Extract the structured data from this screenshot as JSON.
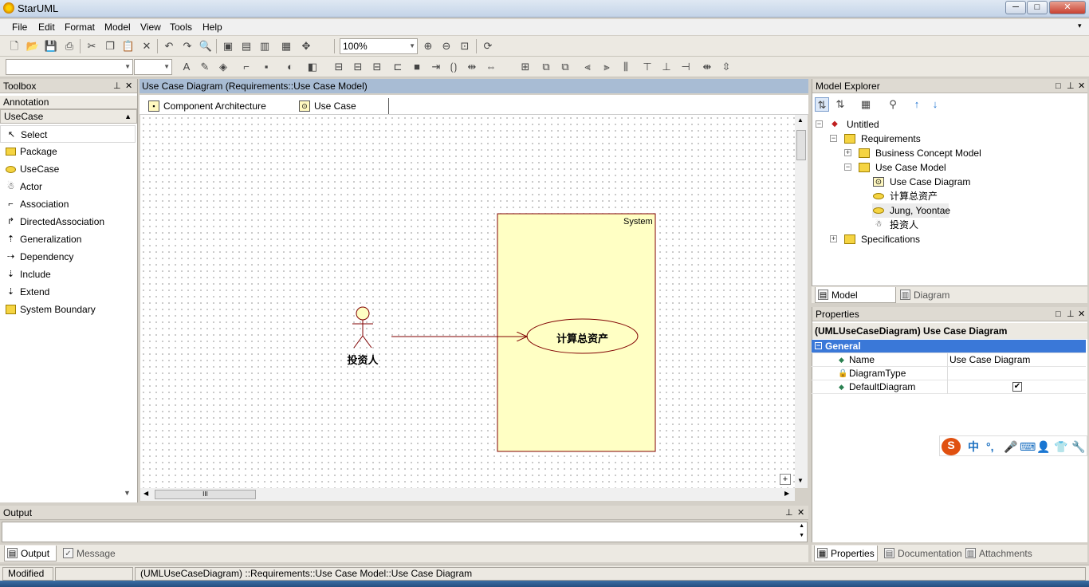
{
  "window": {
    "title": "StarUML",
    "minimize": "─",
    "maximize": "□",
    "close": "✕"
  },
  "menu": [
    "File",
    "Edit",
    "Format",
    "Model",
    "View",
    "Tools",
    "Help"
  ],
  "toolbar": {
    "zoom": "100%"
  },
  "toolbox": {
    "title": "Toolbox",
    "annotation_label": "Annotation",
    "category": "UseCase",
    "items": [
      {
        "label": "Select",
        "icon": "select-arrow-icon"
      },
      {
        "label": "Package",
        "icon": "package-icon"
      },
      {
        "label": "UseCase",
        "icon": "usecase-icon"
      },
      {
        "label": "Actor",
        "icon": "actor-icon"
      },
      {
        "label": "Association",
        "icon": "association-icon"
      },
      {
        "label": "DirectedAssociation",
        "icon": "directed-association-icon"
      },
      {
        "label": "Generalization",
        "icon": "generalization-icon"
      },
      {
        "label": "Dependency",
        "icon": "dependency-icon"
      },
      {
        "label": "Include",
        "icon": "include-icon"
      },
      {
        "label": "Extend",
        "icon": "extend-icon"
      },
      {
        "label": "System Boundary",
        "icon": "system-boundary-icon"
      }
    ]
  },
  "diagram": {
    "header": "Use Case Diagram (Requirements::Use Case Model)",
    "tabs": [
      "Component Architecture Diagram",
      "Use Case Diagram"
    ],
    "system_label": "System",
    "usecase_label": "计算总资产",
    "actor_label": "投资人",
    "hscroll_thumb": "III",
    "colors": {
      "system_fill": "#ffffc4",
      "usecase_fill": "#ffffc4",
      "line": "#800000"
    }
  },
  "explorer": {
    "title": "Model Explorer",
    "tree": [
      {
        "label": "Untitled",
        "expander": "−"
      },
      {
        "label": "Requirements",
        "expander": "−"
      },
      {
        "label": "Business Concept Model",
        "expander": "+"
      },
      {
        "label": "Use Case Model",
        "expander": "−"
      },
      {
        "label": "Use Case Diagram",
        "expander": ""
      },
      {
        "label": "计算总资产",
        "expander": ""
      },
      {
        "label": "Jung, Yoontae",
        "expander": ""
      },
      {
        "label": "投资人",
        "expander": ""
      },
      {
        "label": "Specifications",
        "expander": "+"
      }
    ],
    "tabs": [
      "Model Explorer",
      "Diagram Explorer"
    ]
  },
  "properties": {
    "title": "Properties",
    "heading": "(UMLUseCaseDiagram) Use Case Diagram",
    "group": "General",
    "rows": [
      {
        "name": "Name",
        "value": "Use Case Diagram"
      },
      {
        "name": "DiagramType",
        "value": ""
      },
      {
        "name": "DefaultDiagram",
        "value": "✔"
      }
    ],
    "tabs": [
      "Properties",
      "Documentation",
      "Attachments"
    ]
  },
  "output": {
    "title": "Output",
    "tabs": [
      "Output",
      "Message"
    ]
  },
  "status": {
    "mode": "Modified",
    "path": "(UMLUseCaseDiagram) ::Requirements::Use Case Model::Use Case Diagram"
  },
  "ime": {
    "lang": "中"
  }
}
